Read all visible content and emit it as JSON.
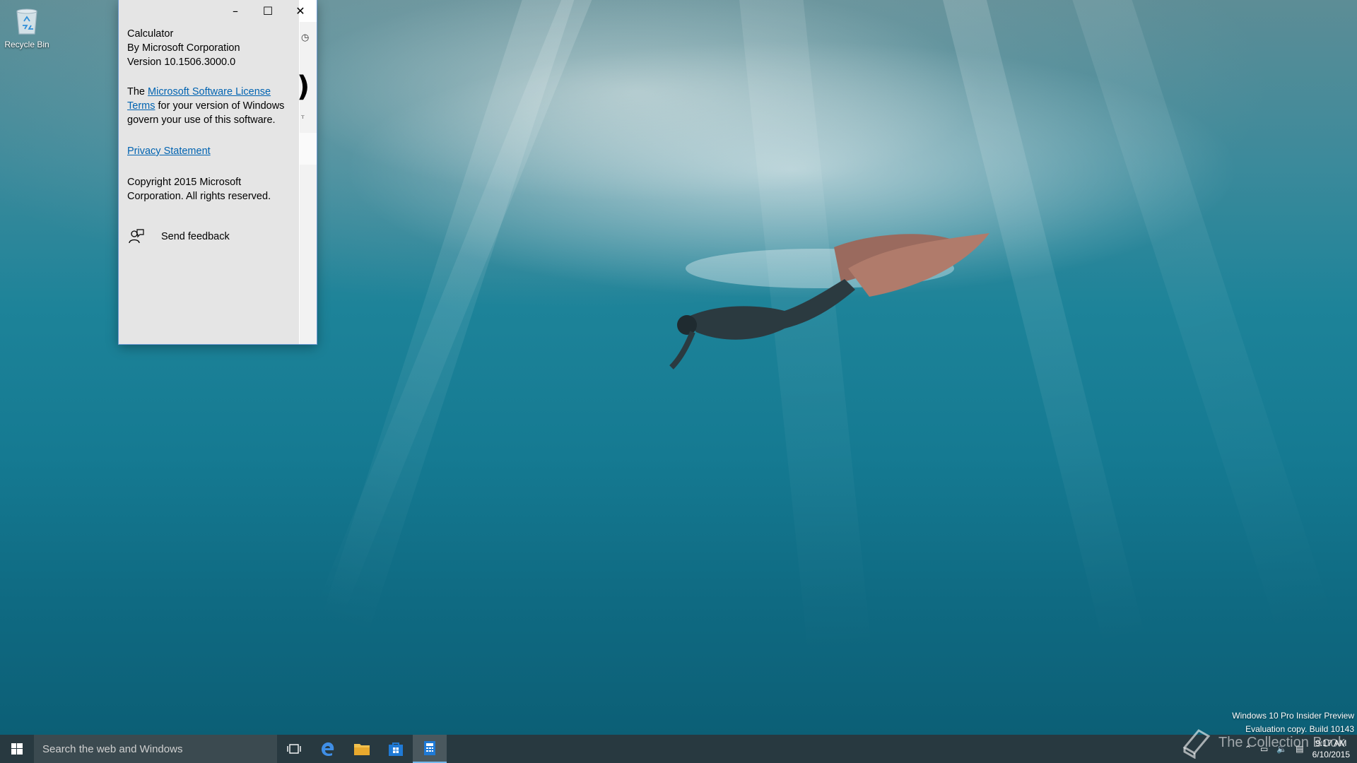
{
  "desktop": {
    "recycle_bin_label": "Recycle Bin",
    "watermark_line1": "Windows 10 Pro Insider Preview",
    "watermark_line2": "Evaluation copy. Build 10143",
    "brand_text": "The Collection Book"
  },
  "window": {
    "minimize_glyph": "–",
    "maximize_glyph": "☐",
    "close_glyph": "✕",
    "behind_history_glyph": "◷",
    "behind_display_digit": ")",
    "behind_memory_glyph": "ᵀ"
  },
  "about": {
    "app_name": "Calculator",
    "publisher": "By Microsoft Corporation",
    "version": "Version 10.1506.3000.0",
    "license_prefix": "The ",
    "license_link": "Microsoft Software License Terms",
    "license_suffix": " for your version of Windows govern your use of this software.",
    "privacy_link": "Privacy Statement",
    "copyright": "Copyright 2015 Microsoft Corporation. All rights reserved.",
    "feedback_label": "Send feedback"
  },
  "taskbar": {
    "search_placeholder": "Search the web and Windows",
    "icons": [
      "task-view-icon",
      "edge-icon",
      "file-explorer-icon",
      "store-icon",
      "calculator-icon"
    ],
    "time": "9:17 AM",
    "date": "6/10/2015",
    "accent_color": "#76b9ed"
  },
  "colors": {
    "link": "#0063b1",
    "about_bg": "#e5e5e5"
  }
}
